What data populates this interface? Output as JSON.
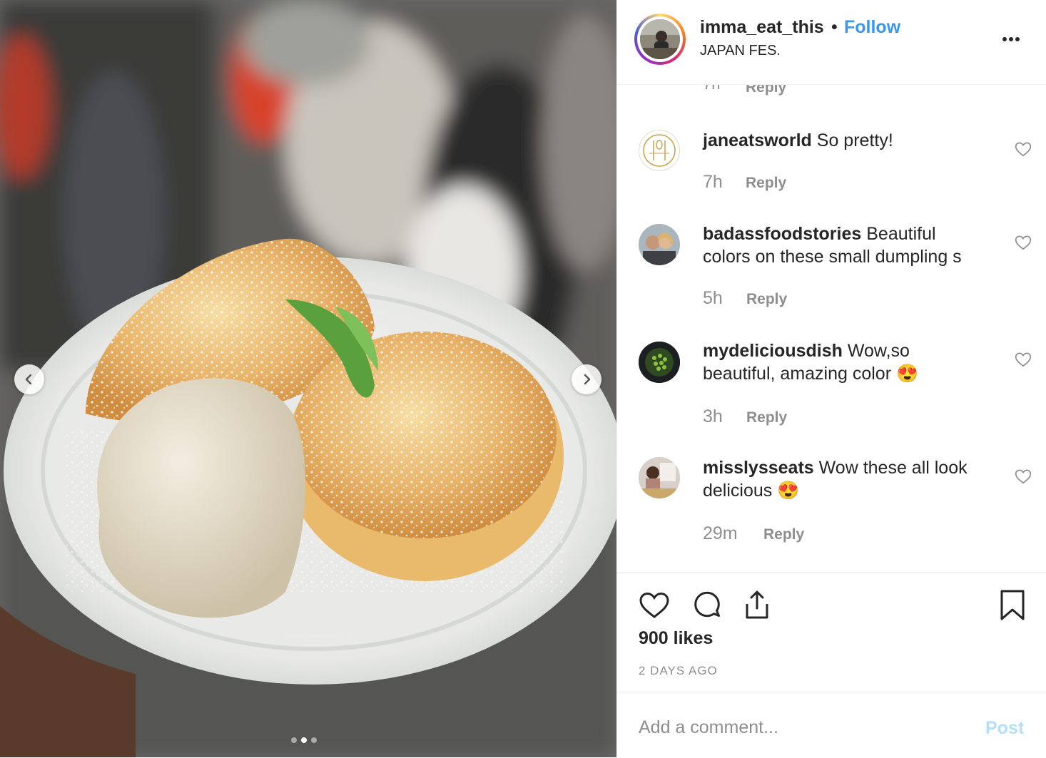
{
  "post": {
    "username": "imma_eat_this",
    "separator": "•",
    "follow_label": "Follow",
    "location": "JAPAN FES.",
    "more_icon": "more-horizontal-icon"
  },
  "photo": {
    "prev_icon": "chevron-left-icon",
    "next_icon": "chevron-right-icon",
    "carousel_count": 3,
    "carousel_active": 2
  },
  "previous_comment": {
    "time": "7h",
    "reply_label": "Reply"
  },
  "comments": [
    {
      "user": "janeatsworld",
      "text": "So pretty!",
      "time": "7h",
      "reply_label": "Reply"
    },
    {
      "user": "badassfoodstories",
      "text": "Beautiful colors on these small dumpling s",
      "time": "5h",
      "reply_label": "Reply"
    },
    {
      "user": "mydeliciousdish",
      "text": "Wow,so beautiful, amazing color 😍",
      "time": "3h",
      "reply_label": "Reply"
    },
    {
      "user": "misslysseats",
      "text": "Wow these all look delicious 😍",
      "time": "29m",
      "reply_label": "Reply"
    }
  ],
  "actions": {
    "likes": "900 likes",
    "time_ago": "2 DAYS AGO"
  },
  "add_comment": {
    "placeholder": "Add a comment...",
    "post_label": "Post"
  },
  "colors": {
    "link": "#3897f0",
    "muted": "#8e8e8e",
    "post_disabled": "#b2dffc"
  }
}
